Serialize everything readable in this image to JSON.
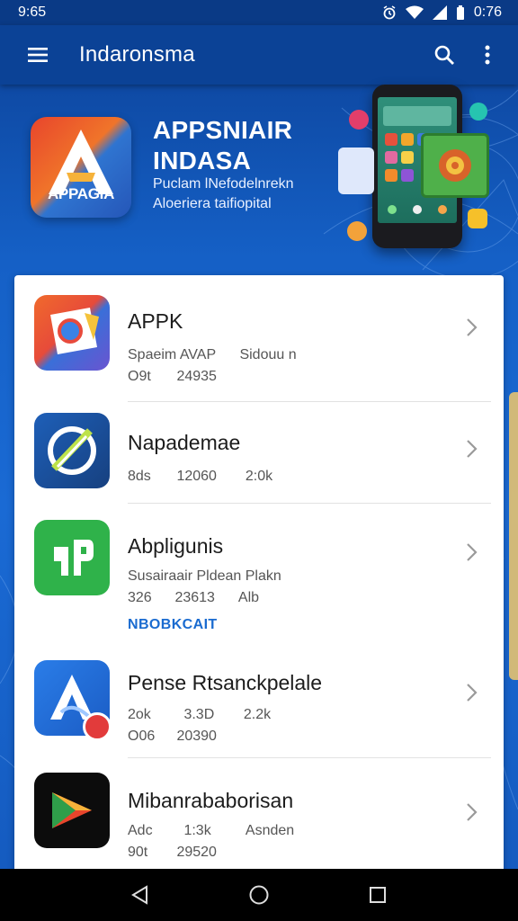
{
  "status_bar": {
    "time_left": "9:65",
    "time_right": "0:76"
  },
  "app_bar": {
    "title": "Indaronsma",
    "icons": [
      "menu-icon",
      "search-icon",
      "more-vert-icon"
    ]
  },
  "hero": {
    "logo_text": "APPAGIA",
    "title_line1": "APPSNIAIR",
    "title_line2": "INDASA",
    "subtitle_line1": "Puclam lNefodelnrekn",
    "subtitle_line2": "Aloeriera taifiopital"
  },
  "apps": [
    {
      "name": "APPK",
      "meta1": [
        "Spaeim AVAP",
        "Sidouu n"
      ],
      "meta2": [
        "O9t",
        "24935"
      ],
      "icon": "chrome-style-icon"
    },
    {
      "name": "Napademae",
      "meta1": [
        "8ds",
        "12060",
        "2:0k"
      ],
      "meta2": [],
      "icon": "compass-icon"
    },
    {
      "name": "Abpligunis",
      "meta1": [
        "Susairaair Pldean Plakn"
      ],
      "meta2": [
        "326",
        "23613",
        "Alb"
      ],
      "icon": "ap-logo-icon"
    },
    {
      "name": "Pense Rtsanckpelale",
      "meta1": [
        "2ok",
        "3.3D",
        "2.2k"
      ],
      "meta2": [
        "O06",
        "20390"
      ],
      "icon": "a-triangle-icon"
    },
    {
      "name": "Mibanrababorisan",
      "meta1": [
        "Adc",
        "1:3k",
        "Asnden"
      ],
      "meta2": [
        "90t",
        "29520"
      ],
      "icon": "play-store-icon"
    }
  ],
  "section_link": "NBOBKCAIT",
  "colors": {
    "app_bar": "#0b4296",
    "accent_link": "#1a6bd0",
    "background": "#1560c6"
  }
}
